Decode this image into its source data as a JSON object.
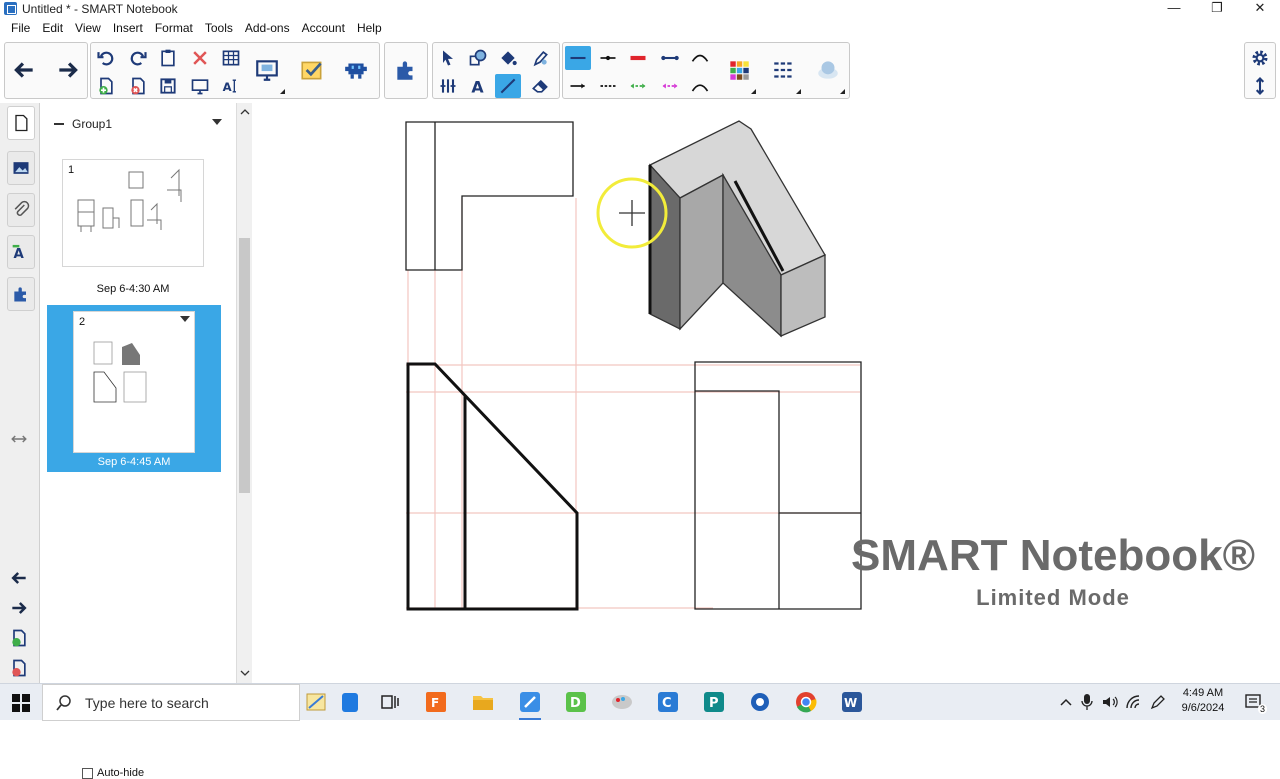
{
  "window": {
    "title": "Untitled * - SMART Notebook",
    "minimize": "—",
    "restore": "❐",
    "close": "✕"
  },
  "menu": [
    "File",
    "Edit",
    "View",
    "Insert",
    "Format",
    "Tools",
    "Add-ons",
    "Account",
    "Help"
  ],
  "toolbar": {
    "icons": [
      "back-arrow-icon",
      "forward-arrow-icon",
      "undo-icon",
      "redo-icon",
      "paste-icon",
      "delete-icon",
      "table-icon",
      "add-page-icon",
      "delete-page-icon",
      "save-icon",
      "full-screen-icon",
      "text-ai-icon",
      "screen-shade-icon",
      "response-icon",
      "activity-builder-icon",
      "addon-icon",
      "select-icon",
      "shapes-icon",
      "fill-icon",
      "pen-icon",
      "magic-pen-icon",
      "text-icon",
      "line-icon",
      "eraser-icon",
      "properties-icon",
      "toolbar-settings-icon",
      "move-toolbar-icon"
    ],
    "line_color_selected": "#3aa7e6"
  },
  "sidebar": {
    "group_label": "Group1",
    "pages": [
      {
        "number": "1",
        "date": "Sep 6-4:30 AM"
      },
      {
        "number": "2",
        "date": "Sep 6-4:45 AM"
      }
    ],
    "autohide_label": "Auto-hide"
  },
  "watermark": {
    "title": "SMART Notebook®",
    "subtitle": "Limited Mode"
  },
  "taskbar": {
    "search_placeholder": "Type here to search",
    "time": "4:49 AM",
    "date": "9/6/2024",
    "notification_count": "3"
  },
  "colors": {
    "accent": "#3aa7e6",
    "watermark": "#6a6a6a",
    "projection_lines": "#f2c6c0"
  }
}
